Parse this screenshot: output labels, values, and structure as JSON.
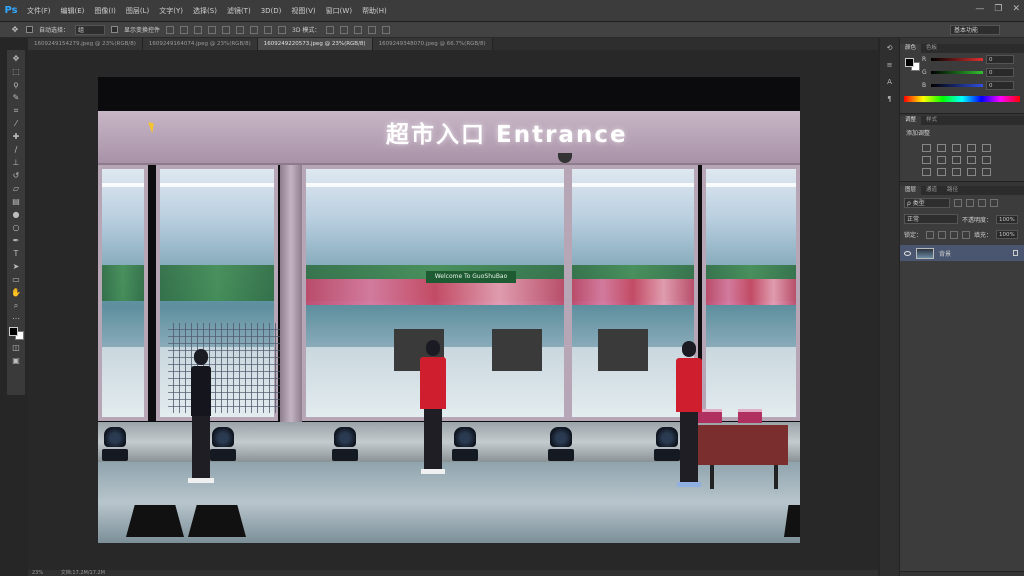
{
  "app": {
    "logo": "Ps"
  },
  "menu": [
    "文件(F)",
    "编辑(E)",
    "图像(I)",
    "图层(L)",
    "文字(Y)",
    "选择(S)",
    "滤镜(T)",
    "3D(D)",
    "视图(V)",
    "窗口(W)",
    "帮助(H)"
  ],
  "window_controls": [
    "—",
    "❐",
    "✕"
  ],
  "options": {
    "auto_select_label": "自动选择：",
    "auto_select_value": "组",
    "show_transform_label": "显示变换控件",
    "mode_3d_label": "3D 模式：",
    "workspace": "基本功能"
  },
  "tabs": [
    {
      "label": "1609249154279.jpeg @ 23%(RGB/8)",
      "active": false
    },
    {
      "label": "1609249164074.jpeg @ 23%(RGB/8)",
      "active": false
    },
    {
      "label": "1609249220573.jpeg @ 23%(RGB/8)",
      "active": true
    },
    {
      "label": "1609249348070.jpeg @ 66.7%(RGB/8)",
      "active": false
    }
  ],
  "photo": {
    "sign": "超市入口 Entrance",
    "banner": "Welcome To GuoShuBao"
  },
  "panels": {
    "color_tabs": [
      "颜色",
      "色板"
    ],
    "channels": [
      {
        "label": "R",
        "value": "0",
        "color": "#e03030"
      },
      {
        "label": "G",
        "value": "0",
        "color": "#30c030"
      },
      {
        "label": "B",
        "value": "0",
        "color": "#3050e0"
      }
    ],
    "adjust_tabs": [
      "调整",
      "样式"
    ],
    "adjust_title": "添加调整",
    "layers_tabs": [
      "图层",
      "通道",
      "路径"
    ],
    "layer_kind": "ρ 类型",
    "blend_mode": "正常",
    "opacity_label": "不透明度：",
    "opacity_value": "100%",
    "lock_label": "锁定：",
    "fill_label": "填充：",
    "fill_value": "100%",
    "layer_name": "背景"
  },
  "status": {
    "zoom": "23%",
    "doc": "文档:17.2M/17.2M"
  }
}
